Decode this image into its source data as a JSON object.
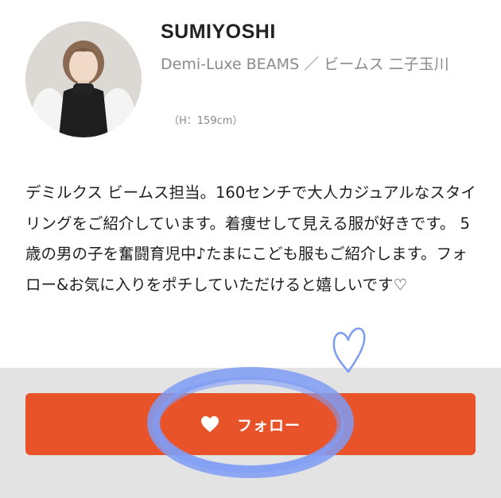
{
  "profile": {
    "name": "SUMIYOSHI",
    "shop": "Demi-Luxe BEAMS ／ ビームス 二子玉川",
    "height": "（H：159cm）",
    "bio": "デミルクス ビームス担当。160センチで大人カジュアルなスタイリングをご紹介しています。着痩せして見える服が好きです。 5歳の男の子を奮闘育児中♪たまにこども服もご紹介します。フォロー&お気に入りをポチしていただけると嬉しいです♡"
  },
  "follow": {
    "label": "フォロー",
    "icon": "heart-icon"
  },
  "colors": {
    "accent": "#e8532a",
    "annotation": "#7f9cf5",
    "bar_background": "#e3e3e3"
  }
}
